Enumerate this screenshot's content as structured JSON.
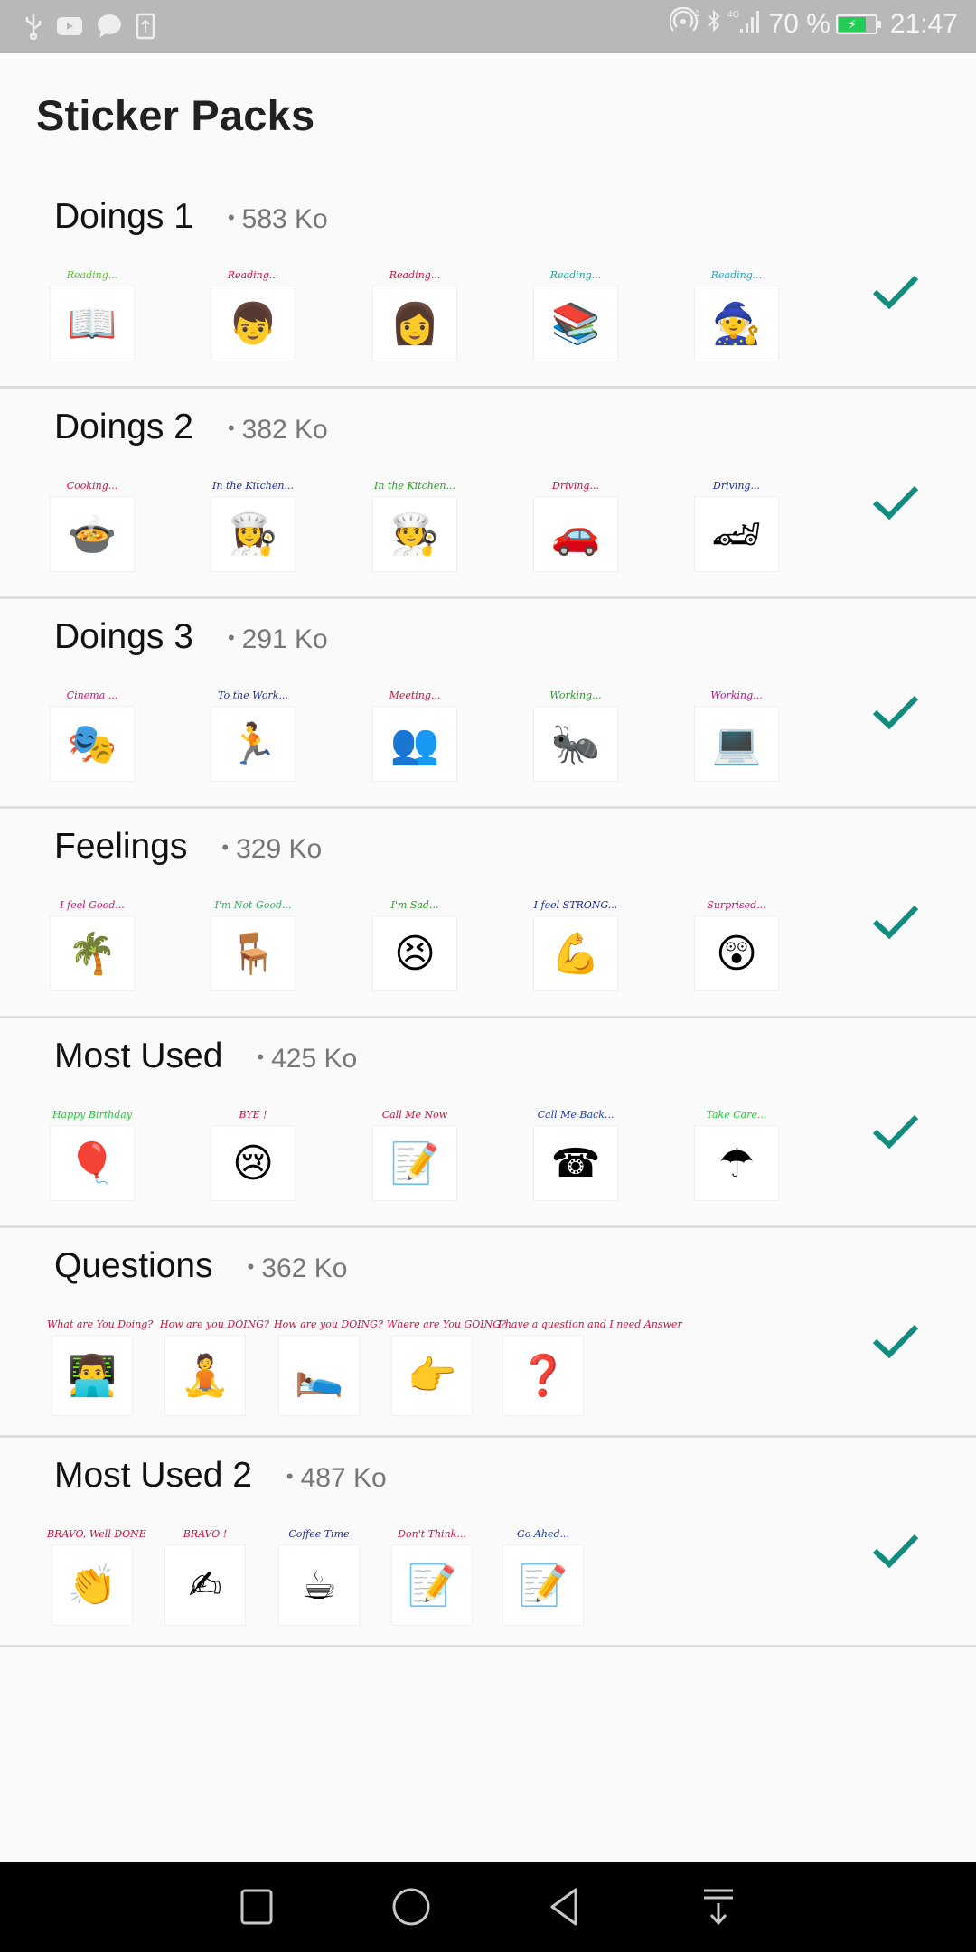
{
  "status_bar": {
    "left_icons": [
      "usb-icon",
      "youtube-icon",
      "message-icon",
      "upload-icon"
    ],
    "hotspot": "1",
    "network": "4G",
    "battery_percent": "70 %",
    "battery_level": 70,
    "time": "21:47"
  },
  "page": {
    "title": "Sticker Packs"
  },
  "accent_color": "#128C7E",
  "packs": [
    {
      "name": "Doings 1",
      "size": "583 Ko",
      "added": true,
      "stickers": [
        {
          "caption": "Reading...",
          "color": "#5cbf3a",
          "icon": "📖"
        },
        {
          "caption": "Reading...",
          "color": "#d0103a",
          "icon": "👦"
        },
        {
          "caption": "Reading...",
          "color": "#d0103a",
          "icon": "👩"
        },
        {
          "caption": "Reading...",
          "color": "#1aa89a",
          "icon": "📚"
        },
        {
          "caption": "Reading...",
          "color": "#18a8c8",
          "icon": "🧙"
        }
      ]
    },
    {
      "name": "Doings 2",
      "size": "382 Ko",
      "added": true,
      "stickers": [
        {
          "caption": "Cooking...",
          "color": "#d0103a",
          "icon": "🍲"
        },
        {
          "caption": "In the Kitchen...",
          "color": "#1a2aa8",
          "icon": "👩‍🍳"
        },
        {
          "caption": "In the Kitchen...",
          "color": "#2a9a2a",
          "icon": "🧑‍🍳"
        },
        {
          "caption": "Driving...",
          "color": "#d0103a",
          "icon": "🚗"
        },
        {
          "caption": "Driving...",
          "color": "#1a2aa8",
          "icon": "🏎"
        }
      ]
    },
    {
      "name": "Doings 3",
      "size": "291 Ko",
      "added": true,
      "stickers": [
        {
          "caption": "Cinema ...",
          "color": "#d0106a",
          "icon": "🎭"
        },
        {
          "caption": "To the Work...",
          "color": "#1a2aa8",
          "icon": "🏃"
        },
        {
          "caption": "Meeting...",
          "color": "#d0103a",
          "icon": "👥"
        },
        {
          "caption": "Working...",
          "color": "#2a9a2a",
          "icon": "🐜"
        },
        {
          "caption": "Working...",
          "color": "#c0108a",
          "icon": "💻"
        }
      ]
    },
    {
      "name": "Feelings",
      "size": "329 Ko",
      "added": true,
      "stickers": [
        {
          "caption": "I feel Good...",
          "color": "#d0106a",
          "icon": "🌴"
        },
        {
          "caption": "I'm Not Good...",
          "color": "#2ab05a",
          "icon": "🪑"
        },
        {
          "caption": "I'm Sad...",
          "color": "#2a9a2a",
          "icon": "😣"
        },
        {
          "caption": "I feel STRONG...",
          "color": "#1a2aa8",
          "icon": "💪"
        },
        {
          "caption": "Surprised...",
          "color": "#c0106a",
          "icon": "😲"
        }
      ]
    },
    {
      "name": "Most Used",
      "size": "425 Ko",
      "added": true,
      "stickers": [
        {
          "caption": "Happy Birthday",
          "color": "#22c83a",
          "icon": "🎈"
        },
        {
          "caption": "BYE !",
          "color": "#d0103a",
          "icon": "😢"
        },
        {
          "caption": "Call Me Now",
          "color": "#d0103a",
          "icon": "📝"
        },
        {
          "caption": "Call Me Back...",
          "color": "#1a3ac8",
          "icon": "☎"
        },
        {
          "caption": "Take Care...",
          "color": "#22c83a",
          "icon": "☂"
        }
      ]
    },
    {
      "name": "Questions",
      "size": "362 Ko",
      "added": true,
      "stickers": [
        {
          "caption": "What are You Doing?",
          "color": "#d0103a",
          "icon": "👨‍💻"
        },
        {
          "caption": "How are you DOING?",
          "color": "#d0103a",
          "icon": "🧘"
        },
        {
          "caption": "How are you DOING?",
          "color": "#d0103a",
          "icon": "🛌"
        },
        {
          "caption": "Where are You GOING?",
          "color": "#d0103a",
          "icon": "👉"
        },
        {
          "caption": "I have a question and I need Answer",
          "color": "#d0103a",
          "icon": "❓"
        }
      ]
    },
    {
      "name": "Most Used 2",
      "size": "487 Ko",
      "added": true,
      "stickers": [
        {
          "caption": "BRAVO, Well DONE",
          "color": "#d0103a",
          "icon": "👏"
        },
        {
          "caption": "BRAVO !",
          "color": "#d0103a",
          "icon": "✍"
        },
        {
          "caption": "Coffee Time",
          "color": "#1a2aa8",
          "icon": "☕"
        },
        {
          "caption": "Don't Think...",
          "color": "#d0103a",
          "icon": "📝"
        },
        {
          "caption": "Go Ahed...",
          "color": "#1a3ac8",
          "icon": "📝"
        }
      ]
    }
  ],
  "nav": {
    "recents": "recents-button",
    "home": "home-button",
    "back": "back-button",
    "notifications": "notification-pulldown-button"
  }
}
